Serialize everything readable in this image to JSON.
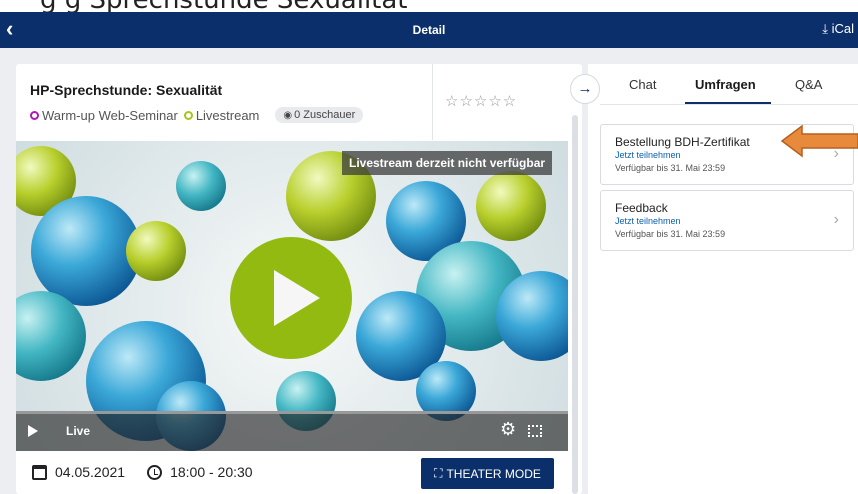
{
  "top_strip_text": "g                g Sprechstunde Sexualität",
  "header": {
    "back_icon": "chevron-left-icon",
    "title": "Detail",
    "ical_label": "iCal",
    "ical_icon": "download-icon"
  },
  "event": {
    "title": "HP-Sprechstunde: Sexualität",
    "tags": [
      {
        "label": "Warm-up Web-Seminar",
        "color": "#b018b8"
      },
      {
        "label": "Livestream",
        "color": "#a9c21b"
      }
    ],
    "viewers": "0 Zuschauer",
    "rating_stars": "☆☆☆☆☆"
  },
  "video": {
    "unavailable_label": "Livestream derzeit nicht verfügbar",
    "live_label": "Live"
  },
  "schedule": {
    "date": "04.05.2021",
    "time": "18:00 - 20:30"
  },
  "theater_button": {
    "label": "THEATER MODE"
  },
  "sidebar": {
    "tabs": [
      {
        "label": "Chat",
        "active": false
      },
      {
        "label": "Umfragen",
        "active": true
      },
      {
        "label": "Q&A",
        "active": false
      }
    ],
    "polls": [
      {
        "title": "Bestellung BDH-Zertifikat",
        "link": "Jetzt teilnehmen",
        "until": "Verfügbar bis 31. Mai 23:59"
      },
      {
        "title": "Feedback",
        "link": "Jetzt teilnehmen",
        "until": "Verfügbar bis 31. Mai 23:59"
      }
    ]
  },
  "colors": {
    "primary": "#0b2f6b",
    "accent_green": "#93ba10",
    "annotation_orange": "#e88a3c"
  }
}
